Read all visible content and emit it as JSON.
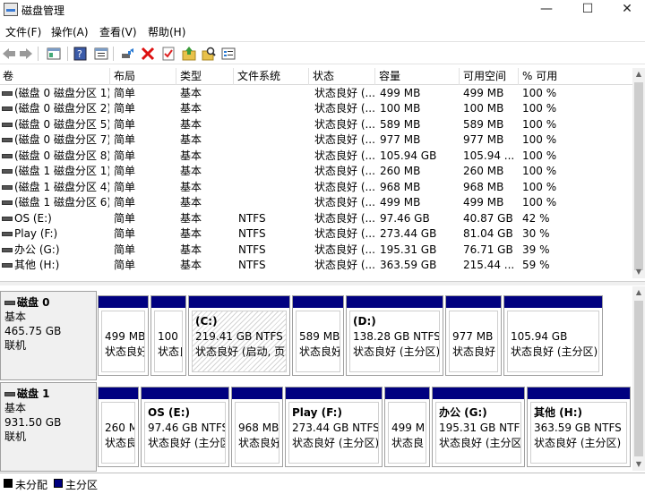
{
  "window": {
    "title": "磁盘管理",
    "minimize_glyph": "—",
    "maximize_glyph": "☐",
    "close_glyph": "✕"
  },
  "menu": [
    "文件(F)",
    "操作(A)",
    "查看(V)",
    "帮助(H)"
  ],
  "toolbar_icons": [
    "back-icon",
    "forward-icon",
    "console-tree-icon",
    "help-icon",
    "properties-icon",
    "connect-icon",
    "delete-icon",
    "check-icon",
    "up-folder-icon",
    "find-icon",
    "settings-icon"
  ],
  "volume_table": {
    "headers": [
      "卷",
      "布局",
      "类型",
      "文件系统",
      "状态",
      "容量",
      "可用空间",
      "% 可用"
    ],
    "rows": [
      [
        "(磁盘 0 磁盘分区 1)",
        "简单",
        "基本",
        "",
        "状态良好 (...",
        "499 MB",
        "499 MB",
        "100 %"
      ],
      [
        "(磁盘 0 磁盘分区 2)",
        "简单",
        "基本",
        "",
        "状态良好 (...",
        "100 MB",
        "100 MB",
        "100 %"
      ],
      [
        "(磁盘 0 磁盘分区 5)",
        "简单",
        "基本",
        "",
        "状态良好 (...",
        "589 MB",
        "589 MB",
        "100 %"
      ],
      [
        "(磁盘 0 磁盘分区 7)",
        "简单",
        "基本",
        "",
        "状态良好 (...",
        "977 MB",
        "977 MB",
        "100 %"
      ],
      [
        "(磁盘 0 磁盘分区 8)",
        "简单",
        "基本",
        "",
        "状态良好 (...",
        "105.94 GB",
        "105.94 ...",
        "100 %"
      ],
      [
        "(磁盘 1 磁盘分区 1)",
        "简单",
        "基本",
        "",
        "状态良好 (...",
        "260 MB",
        "260 MB",
        "100 %"
      ],
      [
        "(磁盘 1 磁盘分区 4)",
        "简单",
        "基本",
        "",
        "状态良好 (...",
        "968 MB",
        "968 MB",
        "100 %"
      ],
      [
        "(磁盘 1 磁盘分区 6)",
        "简单",
        "基本",
        "",
        "状态良好 (...",
        "499 MB",
        "499 MB",
        "100 %"
      ],
      [
        "OS (E:)",
        "简单",
        "基本",
        "NTFS",
        "状态良好 (...",
        "97.46 GB",
        "40.87 GB",
        "42 %"
      ],
      [
        "Play (F:)",
        "简单",
        "基本",
        "NTFS",
        "状态良好 (...",
        "273.44 GB",
        "81.04 GB",
        "30 %"
      ],
      [
        "办公 (G:)",
        "简单",
        "基本",
        "NTFS",
        "状态良好 (...",
        "195.31 GB",
        "76.71 GB",
        "39 %"
      ],
      [
        "其他 (H:)",
        "简单",
        "基本",
        "NTFS",
        "状态良好 (...",
        "363.59 GB",
        "215.44 ...",
        "59 %"
      ]
    ]
  },
  "disks": [
    {
      "name": "磁盘 0",
      "type": "基本",
      "size": "465.75 GB",
      "state": "联机",
      "partitions": [
        {
          "name": "",
          "size": "499 MB",
          "status": "状态良好"
        },
        {
          "name": "",
          "size": "100 M",
          "status": "状态良"
        },
        {
          "name": "(C:)",
          "size": "219.41 GB NTFS",
          "status": "状态良好 (启动, 页面"
        },
        {
          "name": "",
          "size": "589 MB",
          "status": "状态良好"
        },
        {
          "name": "(D:)",
          "size": "138.28 GB NTFS",
          "status": "状态良好 (主分区)"
        },
        {
          "name": "",
          "size": "977 MB",
          "status": "状态良好"
        },
        {
          "name": "",
          "size": "105.94 GB",
          "status": "状态良好 (主分区)"
        }
      ]
    },
    {
      "name": "磁盘 1",
      "type": "基本",
      "size": "931.50 GB",
      "state": "联机",
      "partitions": [
        {
          "name": "",
          "size": "260 M",
          "status": "状态良"
        },
        {
          "name": "OS  (E:)",
          "size": "97.46 GB NTFS",
          "status": "状态良好 (主分区"
        },
        {
          "name": "",
          "size": "968 MB",
          "status": "状态良好"
        },
        {
          "name": "Play  (F:)",
          "size": "273.44 GB NTFS",
          "status": "状态良好 (主分区)"
        },
        {
          "name": "",
          "size": "499 M",
          "status": "状态良"
        },
        {
          "name": "办公  (G:)",
          "size": "195.31 GB NTFS",
          "status": "状态良好 (主分区)"
        },
        {
          "name": "其他  (H:)",
          "size": "363.59 GB NTFS",
          "status": "状态良好 (主分区)"
        }
      ]
    }
  ],
  "legend": [
    {
      "label": "未分配",
      "color": "#000000"
    },
    {
      "label": "主分区",
      "color": "#000080"
    }
  ]
}
